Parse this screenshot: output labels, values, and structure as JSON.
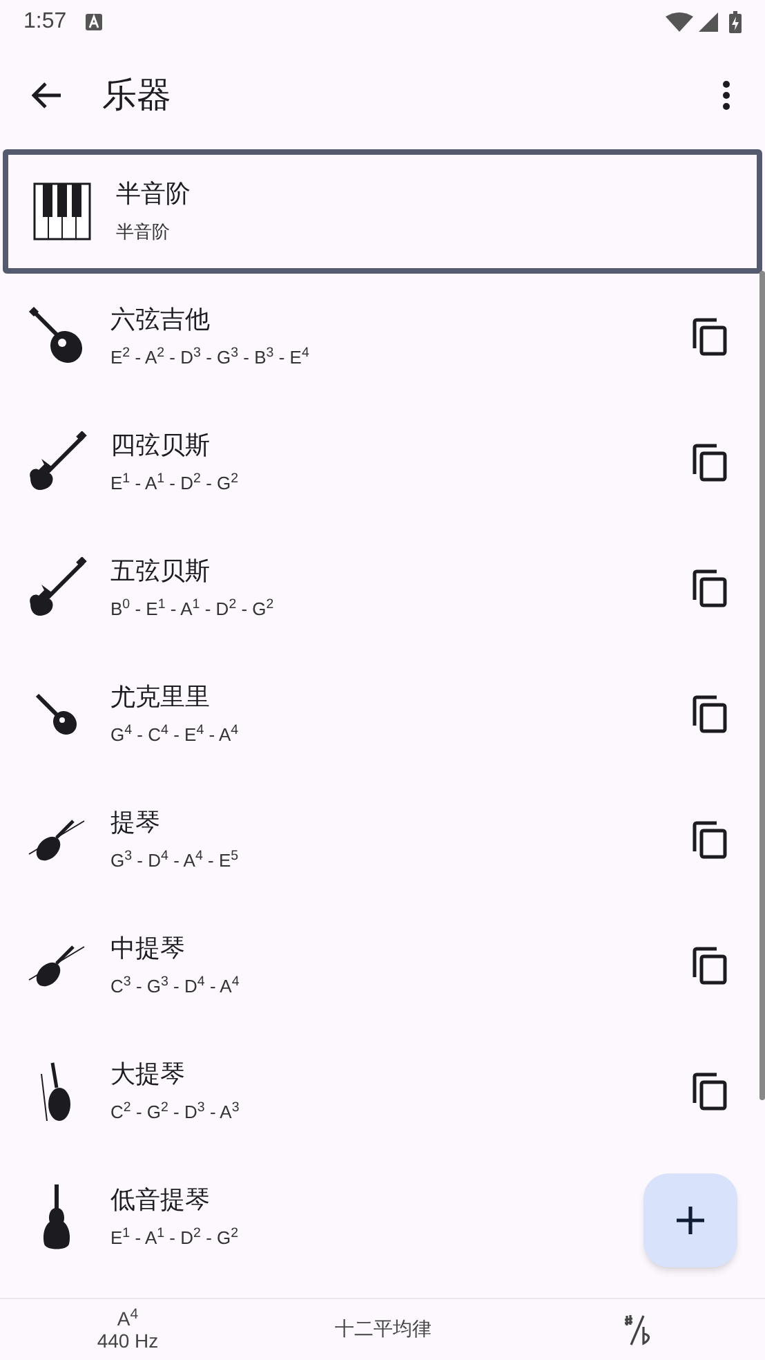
{
  "status_bar": {
    "time": "1:57"
  },
  "app_bar": {
    "title": "乐器"
  },
  "instruments": [
    {
      "kind": "piano",
      "name": "半音阶",
      "tuning": "半音阶",
      "selected": true,
      "copyable": false
    },
    {
      "kind": "guitar",
      "name": "六弦吉他",
      "tuning": "E$^{2}$ - A$^{2}$ - D$^{3}$ - G$^{3}$ - B$^{3}$ - E$^{4}$",
      "selected": false,
      "copyable": true
    },
    {
      "kind": "bass",
      "name": "四弦贝斯",
      "tuning": "E$^{1}$ - A$^{1}$ - D$^{2}$ - G$^{2}$",
      "selected": false,
      "copyable": true
    },
    {
      "kind": "bass",
      "name": "五弦贝斯",
      "tuning": "B$^{0}$ - E$^{1}$ - A$^{1}$ - D$^{2}$ - G$^{2}$",
      "selected": false,
      "copyable": true
    },
    {
      "kind": "ukulele",
      "name": "尤克里里",
      "tuning": "G$^{4}$ - C$^{4}$ - E$^{4}$ - A$^{4}$",
      "selected": false,
      "copyable": true
    },
    {
      "kind": "violin",
      "name": "提琴",
      "tuning": "G$^{3}$ - D$^{4}$ - A$^{4}$ - E$^{5}$",
      "selected": false,
      "copyable": true
    },
    {
      "kind": "violin",
      "name": "中提琴",
      "tuning": "C$^{3}$ - G$^{3}$ - D$^{4}$ - A$^{4}$",
      "selected": false,
      "copyable": true
    },
    {
      "kind": "cello",
      "name": "大提琴",
      "tuning": "C$^{2}$ - G$^{2}$ - D$^{3}$ - A$^{3}$",
      "selected": false,
      "copyable": true
    },
    {
      "kind": "doublebass",
      "name": "低音提琴",
      "tuning": "E$^{1}$ - A$^{1}$ - D$^{2}$ - G$^{2}$",
      "selected": false,
      "copyable": false
    }
  ],
  "bottom_bar": {
    "reference_note": "A$^{4}$",
    "reference_frequency": "440 Hz",
    "temperament": "十二平均律"
  }
}
